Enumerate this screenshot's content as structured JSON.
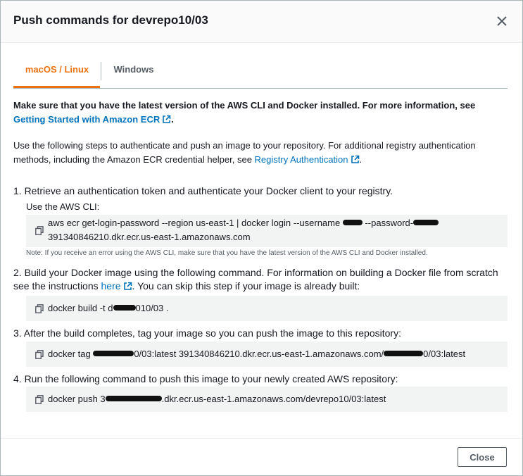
{
  "modal": {
    "title": "Push commands for devrepo10/03",
    "close_button": "Close"
  },
  "tabs": [
    {
      "label": "macOS / Linux",
      "active": true
    },
    {
      "label": "Windows",
      "active": false
    }
  ],
  "intro": {
    "text": "Make sure that you have the latest version of the AWS CLI and Docker installed. For more information, see ",
    "link": "Getting Started with Amazon ECR",
    "suffix": "."
  },
  "auth_info": {
    "text": "Use the following steps to authenticate and push an image to your repository. For additional registry authentication methods, including the Amazon ECR credential helper, see ",
    "link": "Registry Authentication",
    "suffix": "."
  },
  "steps": [
    {
      "text": "1. Retrieve an authentication token and authenticate your Docker client to your registry.",
      "sublabel": "Use the AWS CLI:",
      "code_line1_a": "aws ecr get-login-password --region us-east-1 | docker login --username ",
      "code_line1_b": " --password-",
      "code_line2": "391340846210.dkr.ecr.us-east-1.amazonaws.com",
      "note": "Note: If you receive an error using the AWS CLI, make sure that you have the latest version of the AWS CLI and Docker installed."
    },
    {
      "text_a": "2. Build your Docker image using the following command. For information on building a Docker file from scratch see the instructions ",
      "link": "here",
      "text_b": ". You can skip this step if your image is already built:",
      "code_a": "docker build -t d",
      "code_b": "010/03 ."
    },
    {
      "text": "3. After the build completes, tag your image so you can push the image to this repository:",
      "code_a": "docker tag ",
      "code_b": "0/03:latest 391340846210.dkr.ecr.us-east-1.amazonaws.com/",
      "code_c": "0/03:latest"
    },
    {
      "text": "4. Run the following command to push this image to your newly created AWS repository:",
      "code_a": "docker push 3",
      "code_b": ".dkr.ecr.us-east-1.amazonaws.com/devrepo10/03:latest"
    }
  ],
  "colors": {
    "accent": "#ec7211",
    "link": "#0073bb",
    "code_bg": "#f2f3f3"
  },
  "icons": [
    "close-icon",
    "external-link-icon",
    "copy-icon"
  ]
}
